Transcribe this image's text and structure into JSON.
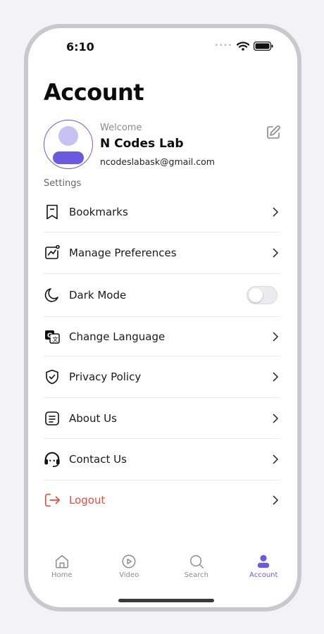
{
  "status": {
    "time": "6:10"
  },
  "page": {
    "title": "Account"
  },
  "profile": {
    "welcome": "Welcome",
    "name": "N Codes Lab",
    "email": "ncodeslabask@gmail.com"
  },
  "settings": {
    "label": "Settings",
    "items": [
      {
        "label": "Bookmarks",
        "icon": "bookmark-icon"
      },
      {
        "label": "Manage Preferences",
        "icon": "preferences-chart-icon"
      },
      {
        "label": "Dark Mode",
        "icon": "moon-icon",
        "toggle": false
      },
      {
        "label": "Change Language",
        "icon": "translate-icon"
      },
      {
        "label": "Privacy Policy",
        "icon": "shield-check-icon"
      },
      {
        "label": "About Us",
        "icon": "document-icon"
      },
      {
        "label": "Contact Us",
        "icon": "headset-icon"
      },
      {
        "label": "Logout",
        "icon": "logout-icon"
      }
    ]
  },
  "tabs": [
    {
      "label": "Home",
      "icon": "home-icon",
      "active": false
    },
    {
      "label": "Video",
      "icon": "play-circle-icon",
      "active": false
    },
    {
      "label": "Search",
      "icon": "search-icon",
      "active": false
    },
    {
      "label": "Account",
      "icon": "user-icon",
      "active": true
    }
  ],
  "colors": {
    "accent": "#6a5ae0",
    "danger": "#e74c3c",
    "avatar_head": "#c8c2f2"
  }
}
